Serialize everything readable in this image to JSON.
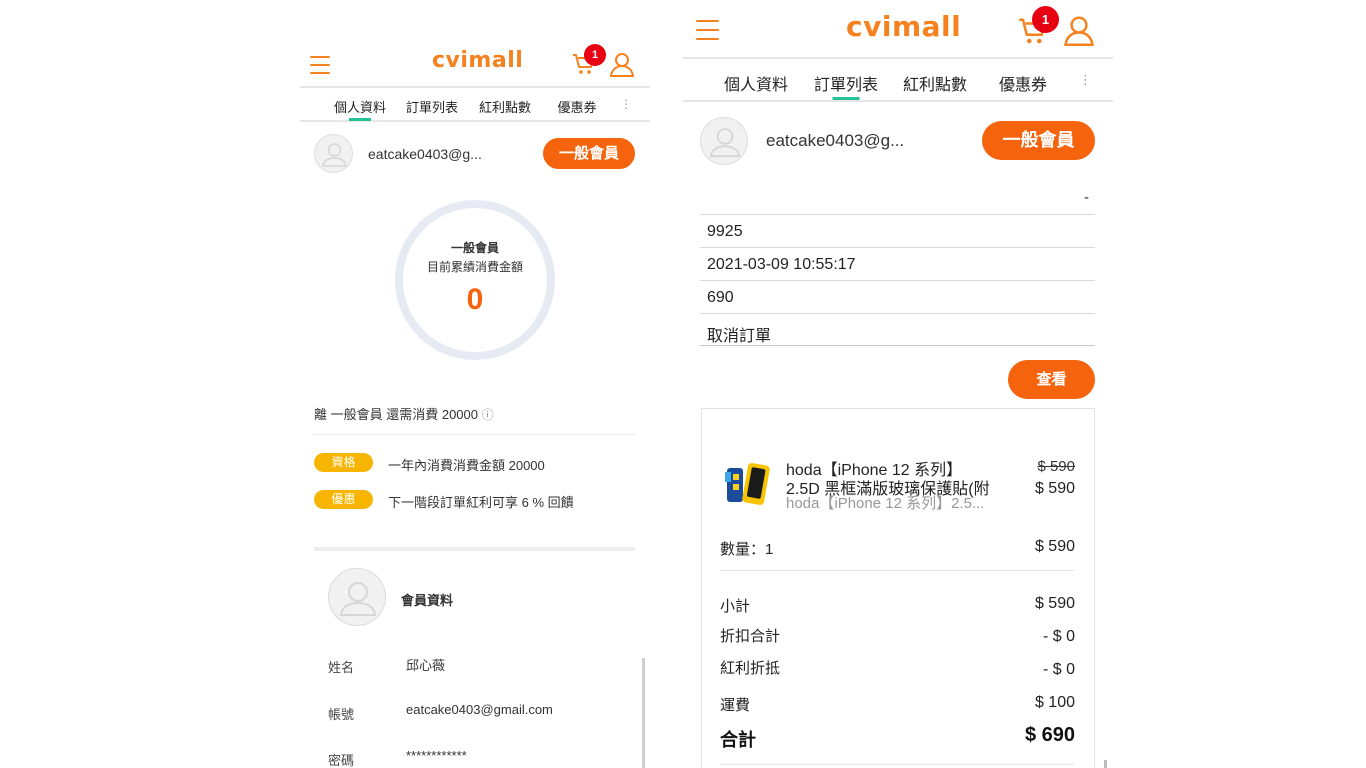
{
  "brand": "cvimall",
  "cart_count": "1",
  "tabs": [
    "個人資料",
    "訂單列表",
    "紅利點數",
    "優惠券"
  ],
  "tabs_more": "⋮",
  "left": {
    "email": "eatcake0403@g...",
    "member_button": "一般會員",
    "circle": {
      "level": "一般會員",
      "caption": "目前累績消費金額",
      "amount": "0"
    },
    "remaining_text": "離 一般會員 還需消費 20000",
    "info_icon": "ⓘ",
    "perks": [
      {
        "tag": "資格",
        "text": "一年內消費消費金額 20000"
      },
      {
        "tag": "優惠",
        "text": "下一階段訂單紅利可享 6 % 回饋"
      }
    ],
    "profile": {
      "title": "會員資料",
      "fields": [
        {
          "label": "姓名",
          "value": "邱心薇"
        },
        {
          "label": "帳號",
          "value": "eatcake0403@gmail.com"
        },
        {
          "label": "密碼",
          "value": "************"
        }
      ]
    }
  },
  "right": {
    "email": "eatcake0403@g...",
    "member_button": "一般會員",
    "order_rows": [
      "-",
      "9925",
      "2021-03-09 10:55:17",
      "690",
      "取消訂單"
    ],
    "view_button": "查看",
    "product": {
      "name_line1": "hoda【iPhone 12 系列】",
      "name_line2": "2.5D 黑框滿版玻璃保護貼(附",
      "name_sub": "hoda【iPhone 12 系列】2.5...",
      "price_original": "$ 590",
      "price_now": "$ 590",
      "qty_label": "數量：1",
      "qty_total": "$ 590"
    },
    "summary": [
      {
        "label": "小計",
        "value": "$ 590"
      },
      {
        "label": "折扣合計",
        "value": "- $ 0"
      },
      {
        "label": "紅利折抵",
        "value": "- $ 0"
      },
      {
        "label": "運費",
        "value": "$ 100"
      }
    ],
    "total": {
      "label": "合計",
      "value": "$ 690"
    }
  }
}
